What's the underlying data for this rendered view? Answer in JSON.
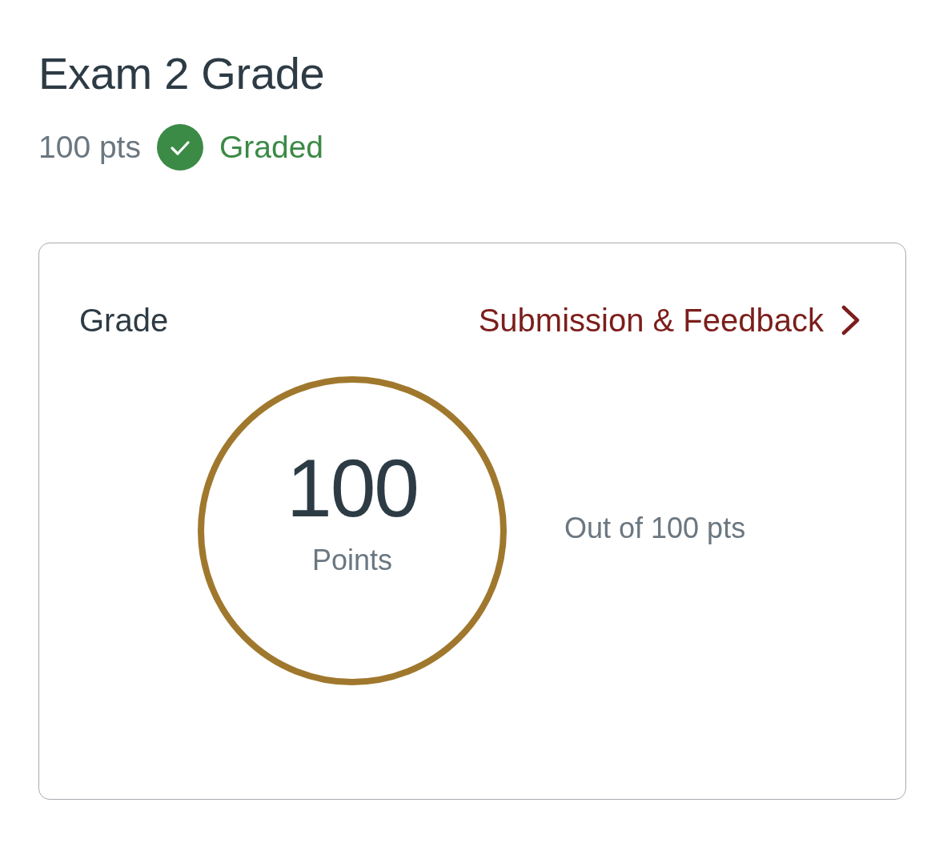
{
  "header": {
    "title": "Exam 2 Grade",
    "points": "100 pts",
    "status": {
      "kind": "graded",
      "label": "Graded"
    }
  },
  "grade_card": {
    "heading": "Grade",
    "link": {
      "label": "Submission & Feedback"
    },
    "score": {
      "value": "100",
      "unit": "Points",
      "level": 1
    },
    "out_of": "Out of 100 pts"
  }
}
